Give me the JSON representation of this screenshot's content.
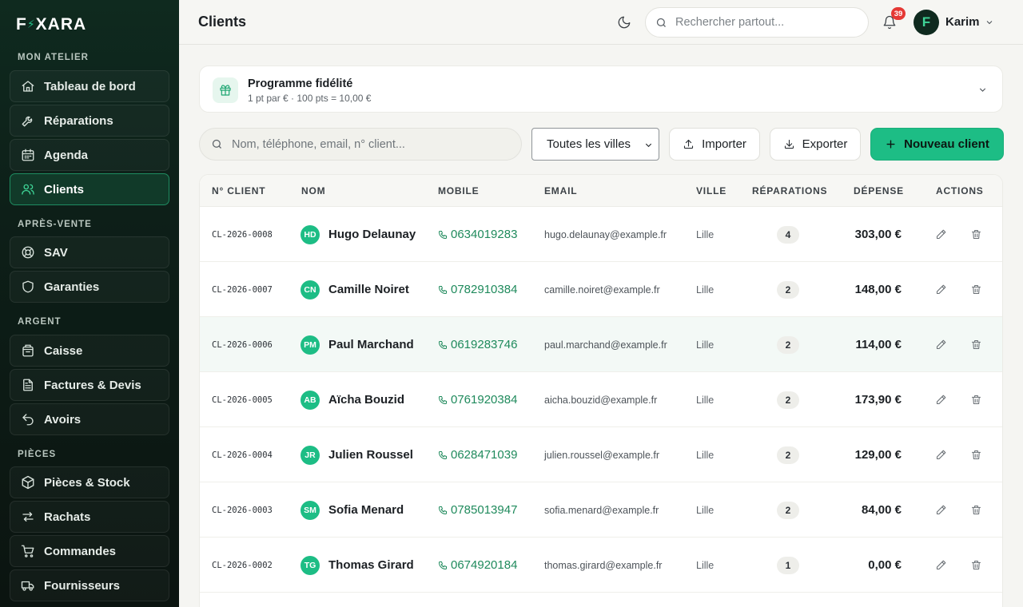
{
  "brand": {
    "logo_left": "F",
    "logo_bolt": "⚡",
    "logo_right": "XARA",
    "accent": "#1dbd85"
  },
  "sidebar": {
    "sections": [
      {
        "title": "MON ATELIER",
        "items": [
          {
            "label": "Tableau de bord",
            "icon": "home-icon"
          },
          {
            "label": "Réparations",
            "icon": "wrench-icon"
          },
          {
            "label": "Agenda",
            "icon": "calendar-icon"
          },
          {
            "label": "Clients",
            "icon": "users-icon",
            "active": true
          }
        ]
      },
      {
        "title": "APRÈS-VENTE",
        "items": [
          {
            "label": "SAV",
            "icon": "lifebuoy-icon"
          },
          {
            "label": "Garanties",
            "icon": "shield-icon"
          }
        ]
      },
      {
        "title": "ARGENT",
        "items": [
          {
            "label": "Caisse",
            "icon": "cash-register-icon"
          },
          {
            "label": "Factures & Devis",
            "icon": "document-icon"
          },
          {
            "label": "Avoirs",
            "icon": "undo-icon"
          }
        ]
      },
      {
        "title": "PIÈCES",
        "items": [
          {
            "label": "Pièces & Stock",
            "icon": "box-icon"
          },
          {
            "label": "Rachats",
            "icon": "swap-icon"
          },
          {
            "label": "Commandes",
            "icon": "cart-icon"
          },
          {
            "label": "Fournisseurs",
            "icon": "truck-icon"
          }
        ]
      }
    ]
  },
  "header": {
    "title": "Clients",
    "search_placeholder": "Rechercher partout...",
    "notifications": "39",
    "user_initial": "F",
    "user_name": "Karim"
  },
  "loyalty": {
    "title": "Programme fidélité",
    "subtitle": "1 pt par € · 100 pts = 10,00 €"
  },
  "toolbar": {
    "search_placeholder": "Nom, téléphone, email, n° client...",
    "city_filter": "Toutes les villes",
    "import_label": "Importer",
    "export_label": "Exporter",
    "new_label": "Nouveau client"
  },
  "table": {
    "headers": {
      "id": "N° CLIENT",
      "name": "NOM",
      "mobile": "MOBILE",
      "email": "EMAIL",
      "city": "VILLE",
      "repairs": "RÉPARATIONS",
      "spend": "DÉPENSE",
      "actions": "ACTIONS"
    },
    "rows": [
      {
        "id": "CL-2026-0008",
        "initials": "HD",
        "name": "Hugo Delaunay",
        "mobile": "0634019283",
        "email": "hugo.delaunay@example.fr",
        "city": "Lille",
        "repairs": "4",
        "spend": "303,00 €"
      },
      {
        "id": "CL-2026-0007",
        "initials": "CN",
        "name": "Camille Noiret",
        "mobile": "0782910384",
        "email": "camille.noiret@example.fr",
        "city": "Lille",
        "repairs": "2",
        "spend": "148,00 €"
      },
      {
        "id": "CL-2026-0006",
        "initials": "PM",
        "name": "Paul Marchand",
        "mobile": "0619283746",
        "email": "paul.marchand@example.fr",
        "city": "Lille",
        "repairs": "2",
        "spend": "114,00 €",
        "highlighted": true
      },
      {
        "id": "CL-2026-0005",
        "initials": "AB",
        "name": "Aïcha Bouzid",
        "mobile": "0761920384",
        "email": "aicha.bouzid@example.fr",
        "city": "Lille",
        "repairs": "2",
        "spend": "173,90 €"
      },
      {
        "id": "CL-2026-0004",
        "initials": "JR",
        "name": "Julien Roussel",
        "mobile": "0628471039",
        "email": "julien.roussel@example.fr",
        "city": "Lille",
        "repairs": "2",
        "spend": "129,00 €"
      },
      {
        "id": "CL-2026-0003",
        "initials": "SM",
        "name": "Sofia Menard",
        "mobile": "0785013947",
        "email": "sofia.menard@example.fr",
        "city": "Lille",
        "repairs": "2",
        "spend": "84,00 €"
      },
      {
        "id": "CL-2026-0002",
        "initials": "TG",
        "name": "Thomas Girard",
        "mobile": "0674920184",
        "email": "thomas.girard@example.fr",
        "city": "Lille",
        "repairs": "1",
        "spend": "0,00 €"
      }
    ]
  }
}
